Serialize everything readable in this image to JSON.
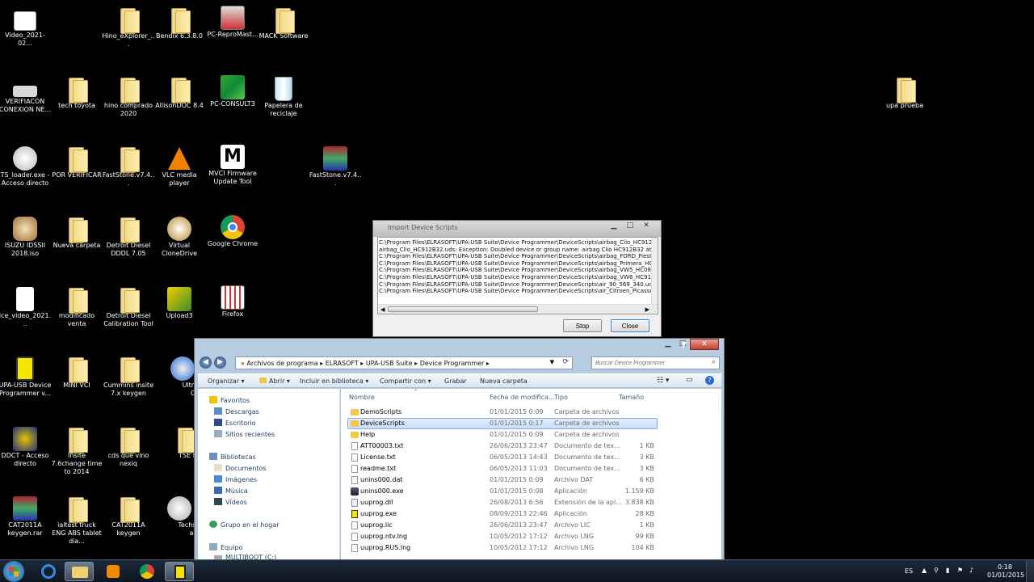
{
  "desktop_icons": [
    {
      "label": "Video_2021-02...",
      "icon": "video-file-icon"
    },
    {
      "label": "Hino_eXplorer_...",
      "icon": "folder-icon"
    },
    {
      "label": "Bendix 6.3.8.0",
      "icon": "folder-icon"
    },
    {
      "label": "PC-ReproMast...",
      "icon": "app-icon"
    },
    {
      "label": "MACK Software",
      "icon": "folder-icon"
    },
    {
      "label": "VERIFIACON CONEXION NE...",
      "icon": "file-icon"
    },
    {
      "label": "tech toyota",
      "icon": "folder-icon"
    },
    {
      "label": "hino comprado 2020",
      "icon": "folder-icon"
    },
    {
      "label": "AllisonDOC 8.4",
      "icon": "folder-icon"
    },
    {
      "label": "PC-CONSULT3",
      "icon": "app-icon"
    },
    {
      "label": "Papelera de reciclaje",
      "icon": "recycle-bin-icon"
    },
    {
      "label": "TS_loader.exe - Acceso directo",
      "icon": "app-icon"
    },
    {
      "label": "POR VERIFICAR",
      "icon": "folder-icon"
    },
    {
      "label": "FastStone.v7.4...",
      "icon": "folder-icon"
    },
    {
      "label": "VLC media player",
      "icon": "vlc-icon"
    },
    {
      "label": "MVCI Firmware Update Tool",
      "icon": "app-icon"
    },
    {
      "label": "FastStone.v7.4...",
      "icon": "winrar-icon"
    },
    {
      "label": "ISUZU IDSSII 2018.iso",
      "icon": "iso-icon"
    },
    {
      "label": "Nueva carpeta",
      "icon": "folder-icon"
    },
    {
      "label": "Detroit Diesel DDDL 7.05",
      "icon": "folder-icon"
    },
    {
      "label": "Virtual CloneDrive",
      "icon": "app-icon"
    },
    {
      "label": "Google Chrome",
      "icon": "chrome-icon"
    },
    {
      "label": "ice_video_2021...",
      "icon": "file-icon"
    },
    {
      "label": "modificado venta",
      "icon": "folder-icon"
    },
    {
      "label": "Detroit Diesel Calibration Tool",
      "icon": "folder-icon"
    },
    {
      "label": "Upload3",
      "icon": "app-icon"
    },
    {
      "label": "Firefox",
      "icon": "app-icon"
    },
    {
      "label": "UPA-USB Device Programmer v...",
      "icon": "app-icon"
    },
    {
      "label": "MINI VCI",
      "icon": "folder-icon"
    },
    {
      "label": "Cummins insite 7.x keygen",
      "icon": "folder-icon"
    },
    {
      "label": "UltraISO",
      "icon": "app-icon"
    },
    {
      "label": "DDCT - Acceso directo",
      "icon": "app-icon"
    },
    {
      "label": "Insite 7.6change time to 2014",
      "icon": "folder-icon"
    },
    {
      "label": "cds que vino nexiq",
      "icon": "folder-icon"
    },
    {
      "label": "TSE file",
      "icon": "folder-icon"
    },
    {
      "label": "CAT2011A keygen.rar",
      "icon": "winrar-icon"
    },
    {
      "label": "ialtest truck ENG ABS tablet dia...",
      "icon": "folder-icon"
    },
    {
      "label": "CAT2011A keygen",
      "icon": "folder-icon"
    },
    {
      "label": "Techstrea",
      "icon": "app-icon"
    },
    {
      "label": "upa prueba",
      "icon": "folder-icon"
    }
  ],
  "import_dialog": {
    "title": "Import Device Scripts",
    "log_lines": [
      "C:\\Program Files\\ELRASOFT\\UPA-USB Suite\\Device Programmer\\DeviceScripts\\airbag_Clio_HC912B32.ud",
      "airbag_Clio_HC912B32.uds: Exception: Doubled device or group name: airbag Clio HC912B32 at 0.229",
      "C:\\Program Files\\ELRASOFT\\UPA-USB Suite\\Device Programmer\\DeviceScripts\\airbag_FORD_Fiesta_ST9",
      "C:\\Program Files\\ELRASOFT\\UPA-USB Suite\\Device Programmer\\DeviceScripts\\airbag_Primera_HC912B3",
      "C:\\Program Files\\ELRASOFT\\UPA-USB Suite\\Device Programmer\\DeviceScripts\\airbag_VW5_HC08AZ32.u",
      "C:\\Program Files\\ELRASOFT\\UPA-USB Suite\\Device Programmer\\DeviceScripts\\airbag_VW6_HC912D60.u",
      "C:\\Program Files\\ELRASOFT\\UPA-USB Suite\\Device Programmer\\DeviceScripts\\air_90_569_340.uds: Inst",
      "C:\\Program Files\\ELRASOFT\\UPA-USB Suite\\Device Programmer\\DeviceScripts\\air_Citroen_Picasso_6023"
    ],
    "stop_label": "Stop",
    "close_label": "Close"
  },
  "explorer": {
    "breadcrumb": [
      "Archivos de programa",
      "ELRASOFT",
      "UPA-USB Suite",
      "Device Programmer"
    ],
    "search_placeholder": "Buscar Device Programmer",
    "toolbar": {
      "organize": "Organizar",
      "open": "Abrir",
      "include": "Incluir en biblioteca",
      "share": "Compartir con",
      "burn": "Grabar",
      "new_folder": "Nueva carpeta"
    },
    "nav": {
      "favorites": "Favoritos",
      "downloads": "Descargas",
      "desktop": "Escritorio",
      "recent": "Sitios recientes",
      "libraries": "Bibliotecas",
      "documents": "Documentos",
      "images": "Imágenes",
      "music": "Música",
      "videos": "Vídeos",
      "homegroup": "Grupo en el hogar",
      "computer": "Equipo",
      "drive": "MULTIBOOT (C:)"
    },
    "columns": {
      "name": "Nombre",
      "date": "Fecha de modifica...",
      "type": "Tipo",
      "size": "Tamaño"
    },
    "files": [
      {
        "name": "DemoScripts",
        "date": "01/01/2015 0:09",
        "type": "Carpeta de archivos",
        "size": "",
        "icon": "folder-icon"
      },
      {
        "name": "DeviceScripts",
        "date": "01/01/2015 0:17",
        "type": "Carpeta de archivos",
        "size": "",
        "icon": "folder-icon"
      },
      {
        "name": "Help",
        "date": "01/01/2015 0:09",
        "type": "Carpeta de archivos",
        "size": "",
        "icon": "folder-icon"
      },
      {
        "name": "ATT00003.txt",
        "date": "26/06/2013 23:47",
        "type": "Documento de tex...",
        "size": "1 KB",
        "icon": "text-file-icon"
      },
      {
        "name": "License.txt",
        "date": "06/05/2013 14:43",
        "type": "Documento de tex...",
        "size": "3 KB",
        "icon": "text-file-icon"
      },
      {
        "name": "readme.txt",
        "date": "06/05/2013 11:03",
        "type": "Documento de tex...",
        "size": "3 KB",
        "icon": "text-file-icon"
      },
      {
        "name": "unins000.dat",
        "date": "01/01/2015 0:09",
        "type": "Archivo DAT",
        "size": "6 KB",
        "icon": "file-icon"
      },
      {
        "name": "unins000.exe",
        "date": "01/01/2015 0:08",
        "type": "Aplicación",
        "size": "1.159 KB",
        "icon": "exe-icon"
      },
      {
        "name": "uuprog.dll",
        "date": "26/08/2013 6:56",
        "type": "Extensión de la apl...",
        "size": "3.838 KB",
        "icon": "dll-icon"
      },
      {
        "name": "uuprog.exe",
        "date": "08/09/2013 22:46",
        "type": "Aplicación",
        "size": "28 KB",
        "icon": "exe-icon"
      },
      {
        "name": "uuprog.lic",
        "date": "26/06/2013 23:47",
        "type": "Archivo LIC",
        "size": "1 KB",
        "icon": "file-icon"
      },
      {
        "name": "uuprog.ntv.lng",
        "date": "10/05/2012 17:12",
        "type": "Archivo LNG",
        "size": "99 KB",
        "icon": "file-icon"
      },
      {
        "name": "uuprog.RUS.lng",
        "date": "10/05/2012 17:12",
        "type": "Archivo LNG",
        "size": "104 KB",
        "icon": "file-icon"
      }
    ],
    "selected_index": 1
  },
  "taskbar": {
    "language": "ES",
    "time": "0:18",
    "date": "01/01/2015"
  }
}
